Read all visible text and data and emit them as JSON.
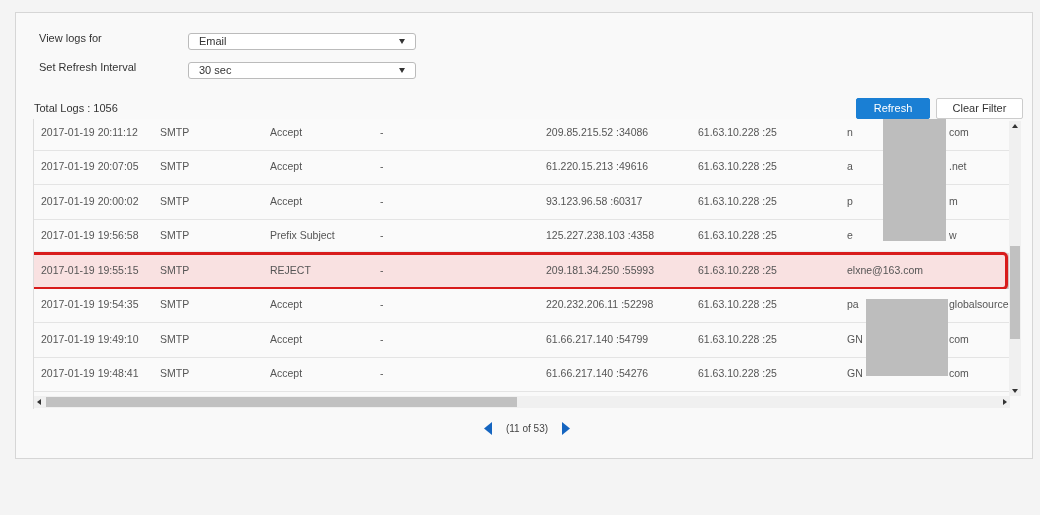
{
  "filters": [
    {
      "label": "View logs for",
      "value": "Email"
    },
    {
      "label": "Set Refresh Interval",
      "value": "30 sec"
    }
  ],
  "total_logs": "Total Logs : 1056",
  "buttons": [
    {
      "label": "Refresh",
      "kind": "primary"
    },
    {
      "label": "Clear Filter",
      "kind": "secondary"
    }
  ],
  "table": {
    "rows": [
      {
        "time": "2017-01-19 20:11:12",
        "protocol": "SMTP",
        "action": "Accept",
        "column_4": "-",
        "source": "209.85.215.52 :34086",
        "destination": "61.63.10.228 :25",
        "sender_start": "n",
        "sender_end": "com",
        "selected": false
      },
      {
        "time": "2017-01-19 20:07:05",
        "protocol": "SMTP",
        "action": "Accept",
        "column_4": "-",
        "source": "61.220.15.213 :49616",
        "destination": "61.63.10.228 :25",
        "sender_start": "a",
        "sender_end": ".net",
        "selected": false
      },
      {
        "time": "2017-01-19 20:00:02",
        "protocol": "SMTP",
        "action": "Accept",
        "column_4": "-",
        "source": "93.123.96.58 :60317",
        "destination": "61.63.10.228 :25",
        "sender_start": "p",
        "sender_end": "m",
        "selected": false
      },
      {
        "time": "2017-01-19 19:56:58",
        "protocol": "SMTP",
        "action": "Prefix Subject",
        "column_4": "-",
        "source": "125.227.238.103 :4358",
        "destination": "61.63.10.228 :25",
        "sender_start": "e",
        "sender_end": "w",
        "selected": false
      },
      {
        "time": "2017-01-19 19:55:15",
        "protocol": "SMTP",
        "action": "REJECT",
        "column_4": "-",
        "source": "209.181.34.250 :55993",
        "destination": "61.63.10.228 :25",
        "sender_start": "elxne@163.com",
        "selected": true
      },
      {
        "time": "2017-01-19 19:54:35",
        "protocol": "SMTP",
        "action": "Accept",
        "column_4": "-",
        "source": "220.232.206.11 :52298",
        "destination": "61.63.10.228 :25",
        "sender_start": "pa",
        "sender_end": "globalsource",
        "selected": false
      },
      {
        "time": "2017-01-19 19:49:10",
        "protocol": "SMTP",
        "action": "Accept",
        "column_4": "-",
        "source": "61.66.217.140 :54799",
        "destination": "61.63.10.228 :25",
        "sender_start": "GN",
        "sender_end": "com",
        "selected": false
      },
      {
        "time": "2017-01-19 19:48:41",
        "protocol": "SMTP",
        "action": "Accept",
        "column_4": "-",
        "source": "61.66.217.140 :54276",
        "destination": "61.63.10.228 :25",
        "sender_start": "GN",
        "sender_end": "com",
        "selected": false
      }
    ]
  },
  "pagination": {
    "label": "(11 of 53)"
  }
}
